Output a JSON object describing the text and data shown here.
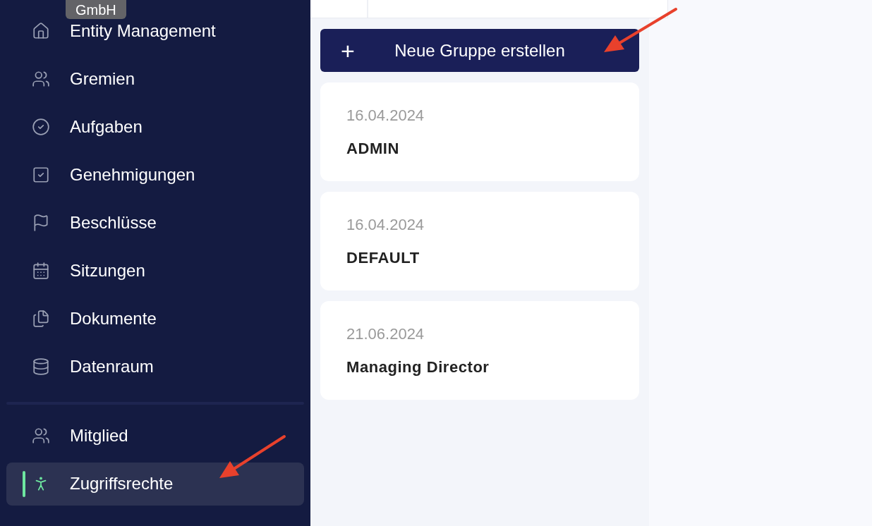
{
  "sidebar": {
    "tooltip": "GmbH",
    "items": [
      {
        "kind": "home",
        "label": "Entity Management",
        "selected": false
      },
      {
        "kind": "users",
        "label": "Gremien",
        "selected": false
      },
      {
        "kind": "tasks",
        "label": "Aufgaben",
        "selected": false
      },
      {
        "kind": "approvals",
        "label": "Genehmigungen",
        "selected": false
      },
      {
        "kind": "resolutions",
        "label": "Beschlüsse",
        "selected": false
      },
      {
        "kind": "meetings",
        "label": "Sitzungen",
        "selected": false
      },
      {
        "kind": "documents",
        "label": "Dokumente",
        "selected": false
      },
      {
        "kind": "dataroom",
        "label": "Datenraum",
        "selected": false
      }
    ],
    "bottom_items": [
      {
        "kind": "users",
        "label": "Mitglied",
        "selected": false
      },
      {
        "kind": "access",
        "label": "Zugriffsrechte",
        "selected": true
      }
    ]
  },
  "main": {
    "create_button": {
      "icon": "+",
      "label": "Neue Gruppe erstellen"
    },
    "groups": [
      {
        "date": "16.04.2024",
        "name": "ADMIN"
      },
      {
        "date": "16.04.2024",
        "name": "DEFAULT"
      },
      {
        "date": "21.06.2024",
        "name": "Managing Director"
      }
    ]
  }
}
